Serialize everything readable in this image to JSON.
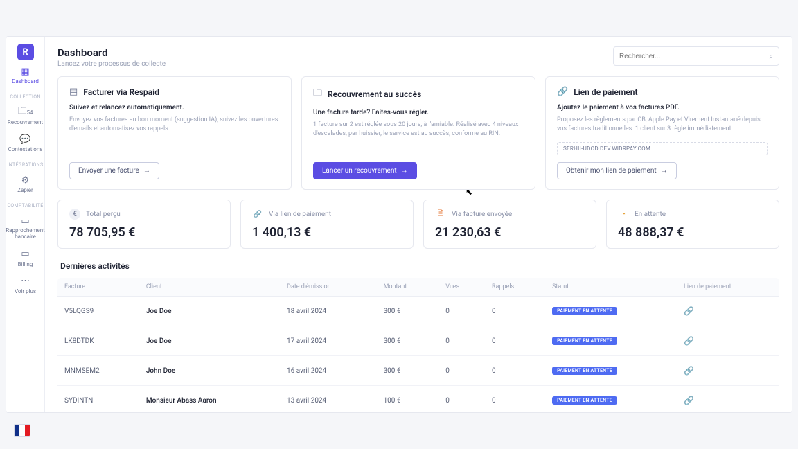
{
  "header": {
    "title": "Dashboard",
    "subtitle": "Lancez votre processus de collecte"
  },
  "search": {
    "placeholder": "Rechercher..."
  },
  "sidebar": {
    "dashboard": "Dashboard",
    "section_collection": "COLLECTION",
    "recouvrement": "Recouvrement",
    "recouvrement_count": "54",
    "contestations": "Contestations",
    "section_integrations": "INTÉGRATIONS",
    "zapier": "Zapier",
    "section_compta": "COMPTABILITÉ",
    "rapprochement": "Rapprochement bancaire",
    "billing": "Billing",
    "voir_plus": "Voir plus"
  },
  "cards": {
    "facturer": {
      "title": "Facturer via Respaid",
      "lead": "Suivez et relancez automatiquement.",
      "desc": "Envoyez vos factures au bon moment (suggestion IA), suivez les ouvertures d'emails et automatisez vos rappels.",
      "cta": "Envoyer une facture"
    },
    "recouvrement": {
      "title": "Recouvrement au succès",
      "lead": "Une facture tarde? Faites-vous régler.",
      "desc": "1 facture sur 2 est réglée sous 20 jours, à l'amiable. Réalisé avec 4 niveaux d'escalades, par huissier, le service est au succès, conforme au RIN.",
      "cta": "Lancer un recouvrement"
    },
    "lien": {
      "title": "Lien de paiement",
      "lead": "Ajoutez le paiement à vos factures PDF.",
      "desc": "Proposez les règlements par CB, Apple Pay et Virement Instantané depuis vos factures traditionnelles. 1 client sur 3 règle immédiatement.",
      "url": "SERHII-UDOD.DEV.WIDRPAY.COM",
      "cta": "Obtenir mon lien de paiement"
    }
  },
  "stats": {
    "total": {
      "label": "Total perçu",
      "value": "78 705,95 €"
    },
    "lien": {
      "label": "Via lien de paiement",
      "value": "1 400,13 €"
    },
    "facture": {
      "label": "Via facture envoyée",
      "value": "21 230,63 €"
    },
    "attente": {
      "label": "En attente",
      "value": "48 888,37 €"
    }
  },
  "activities": {
    "title": "Dernières activités",
    "columns": {
      "facture": "Facture",
      "client": "Client",
      "date": "Date d'émission",
      "montant": "Montant",
      "vues": "Vues",
      "rappels": "Rappels",
      "statut": "Statut",
      "lien": "Lien de paiement"
    },
    "rows": [
      {
        "facture": "V5LQGS9",
        "client": "Joe Doe",
        "date": "18 avril 2024",
        "montant": "300 €",
        "vues": "0",
        "rappels": "0",
        "statut": "PAIEMENT EN ATTENTE"
      },
      {
        "facture": "LK8DTDK",
        "client": "Joe Doe",
        "date": "17 avril 2024",
        "montant": "300 €",
        "vues": "0",
        "rappels": "0",
        "statut": "PAIEMENT EN ATTENTE"
      },
      {
        "facture": "MNMSEM2",
        "client": "John Doe",
        "date": "16 avril 2024",
        "montant": "300 €",
        "vues": "0",
        "rappels": "0",
        "statut": "PAIEMENT EN ATTENTE"
      },
      {
        "facture": "SYDINTN",
        "client": "Monsieur Abass Aaron",
        "date": "13 avril 2024",
        "montant": "100 €",
        "vues": "0",
        "rappels": "0",
        "statut": "PAIEMENT EN ATTENTE"
      }
    ]
  }
}
